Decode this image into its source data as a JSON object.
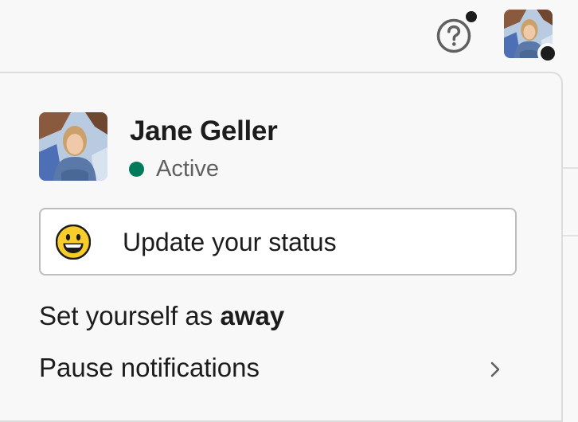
{
  "header": {
    "help_icon": "help-circle-icon",
    "avatar_icon": "user-avatar"
  },
  "user": {
    "name": "Jane Geller",
    "presence": "Active",
    "presence_color": "#007a5a"
  },
  "menu": {
    "status_button": {
      "label": "Update your status",
      "emoji": "grinning-face-emoji"
    },
    "away_item": {
      "prefix": "Set yourself as ",
      "emphasis": "away"
    },
    "pause_item": {
      "label": "Pause notifications",
      "chevron": "chevron-right-icon"
    }
  },
  "colors": {
    "background": "#f8f8f8",
    "text": "#1d1c1d",
    "muted_text": "#616061",
    "border": "#bdbdbd",
    "badge": "#1d1c1d"
  }
}
